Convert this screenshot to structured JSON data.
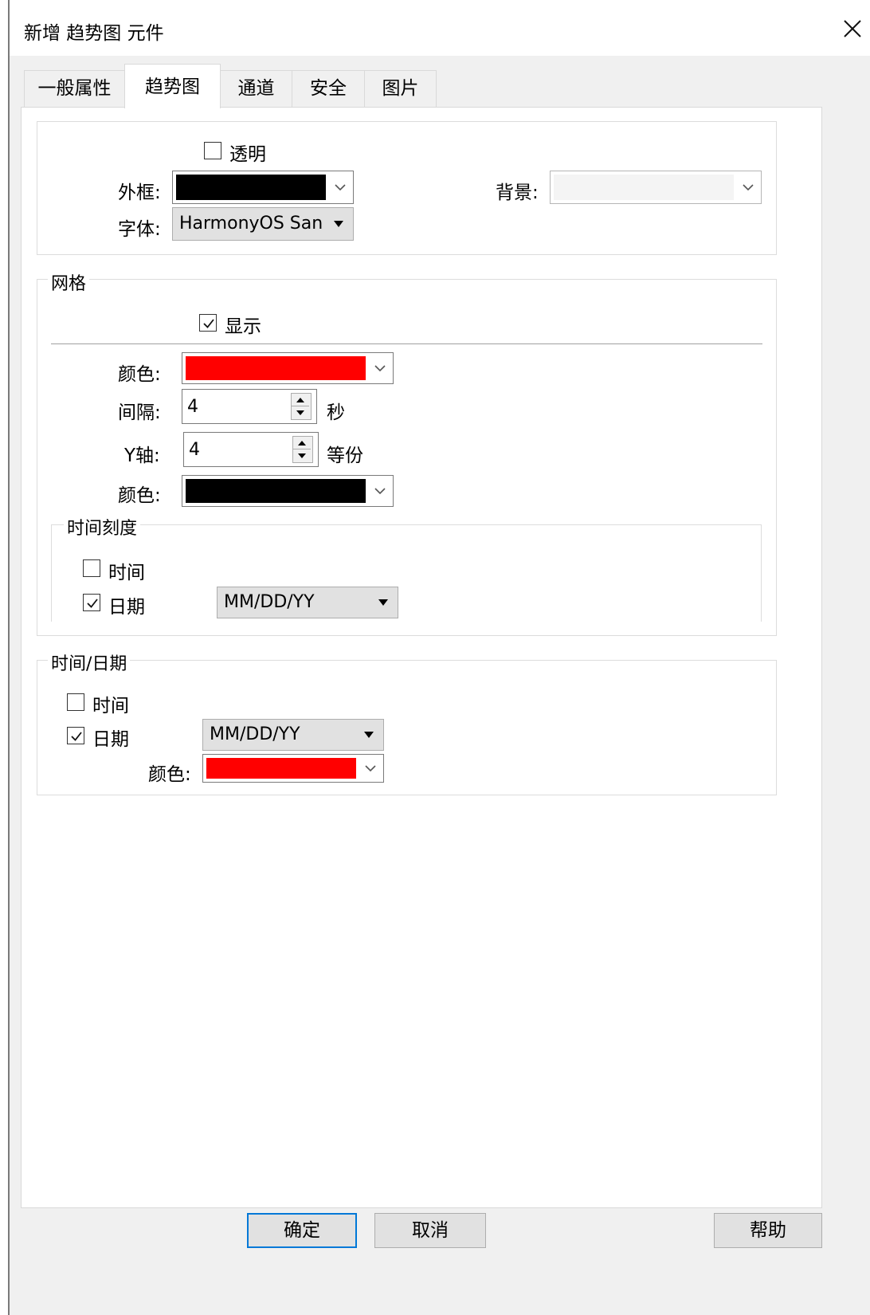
{
  "window": {
    "title": "新增 趋势图 元件",
    "close_icon": "close-icon"
  },
  "tabs": [
    {
      "label": "一般属性"
    },
    {
      "label": "趋势图",
      "active": true
    },
    {
      "label": "通道"
    },
    {
      "label": "安全"
    },
    {
      "label": "图片"
    }
  ],
  "appearance": {
    "transparent_label": "透明",
    "transparent_checked": false,
    "border_label": "外框:",
    "border_color": "#000000",
    "background_label": "背景:",
    "background_color": "",
    "font_label": "字体:",
    "font_value": "HarmonyOS San"
  },
  "grid": {
    "title": "网格",
    "show_label": "显示",
    "show_checked": true,
    "color_label": "颜色:",
    "color": "#ff0000",
    "interval_label": "间隔:",
    "interval_value": "4",
    "interval_unit": "秒",
    "yaxis_label": "Y轴:",
    "yaxis_value": "4",
    "yaxis_unit": "等份",
    "yaxis_color_label": "颜色:",
    "yaxis_color": "#000000",
    "time_scale": {
      "title": "时间刻度",
      "time_label": "时间",
      "time_checked": false,
      "date_label": "日期",
      "date_checked": true,
      "date_format": "MM/DD/YY"
    }
  },
  "time_date": {
    "title": "时间/日期",
    "time_label": "时间",
    "time_checked": false,
    "date_label": "日期",
    "date_checked": true,
    "date_format": "MM/DD/YY",
    "color_label": "颜色:",
    "color": "#ff0000"
  },
  "buttons": {
    "ok": "确定",
    "cancel": "取消",
    "help": "帮助"
  },
  "colors": {
    "dialog_bg": "#f0f0f0",
    "default_button_border": "#0078d7"
  }
}
